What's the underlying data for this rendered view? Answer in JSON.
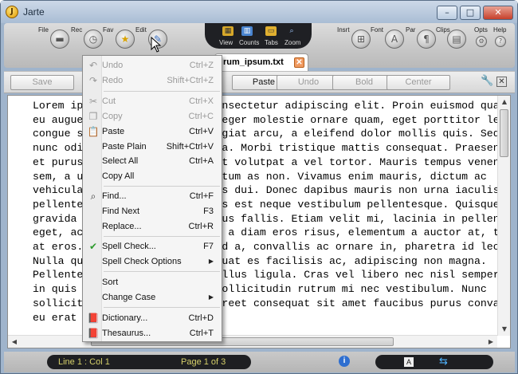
{
  "window": {
    "title": "Jarte",
    "app_icon": "J"
  },
  "ribbon": {
    "left_buttons": [
      {
        "label": "File",
        "icon": "folder-icon"
      },
      {
        "label": "Rec",
        "icon": "clock-icon"
      },
      {
        "label": "Fav",
        "icon": "star-icon"
      },
      {
        "label": "Edit",
        "icon": "edit-icon"
      }
    ],
    "middle": [
      {
        "label": "View"
      },
      {
        "label": "Counts"
      },
      {
        "label": "Tabs"
      },
      {
        "label": "Zoom"
      }
    ],
    "right_buttons": [
      {
        "label": "Insrt"
      },
      {
        "label": "Font"
      },
      {
        "label": "Par"
      },
      {
        "label": "Clips"
      },
      {
        "label": "Opts"
      },
      {
        "label": "Help"
      }
    ]
  },
  "document_tab": {
    "name": "rum_ipsum.txt"
  },
  "toolbar": {
    "save": "Save",
    "paste": "Paste",
    "undo": "Undo",
    "bold": "Bold",
    "center": "Center"
  },
  "editor_text": "Lorem ipsum dolor sit amet, consectetur adipiscing elit. Proin euismod quam\neu augue vehicula dapibus. Integer molestie ornare quam, eget porttitor leo\ncongue sit amet. Phasellus feugiat arcu, a eleifend dolor mollis quis. Sed ut\nnunc odio, sed condimentum urna. Morbi tristique mattis consequat. Praesent\net purus pharetra massa blandit volutpat a vel tortor. Mauris tempus venenatis\nsem, a ultrices ipsum condimentum as non. Vivamus enim mauris, dictum ac\nvehicula ut, hendrerit ultrices dui. Donec dapibus mauris non urna iaculis\npellentesque. Aliquam at luctus est neque vestibulum pellentesque. Quisque\ngravida tellus vel tortor tempus fallis. Etiam velit mi, lacinia in pellentesque\neget, accumsan a felis. Aenean a diam eros risus, elementum a auctor at, tempor\nat eros. Sed vestibulum euismod a, convallis ac ornare in, pharetra id leo.\nNulla quis lectus nibh, consequat es facilisis ac, adipiscing non magna.\nPellentesque eget velit vel tellus ligula. Cras vel libero nec nisl semper pulvinar\nin quis neque. Proin sem mi, sollicitudin rutrum mi nec vestibulum. Nunc\nsollicitudin, libero vitae laoreet consequat sit amet faucibus purus convallis. Ut\neu erat",
  "status": {
    "position": "Line 1 : Col 1",
    "page": "Page 1 of 3"
  },
  "edit_menu": {
    "items": [
      {
        "label": "Undo",
        "shortcut": "Ctrl+Z",
        "disabled": true,
        "icon": "undo-icon"
      },
      {
        "label": "Redo",
        "shortcut": "Shift+Ctrl+Z",
        "disabled": true,
        "icon": "redo-icon"
      },
      {
        "label": "Cut",
        "shortcut": "Ctrl+X",
        "disabled": true,
        "icon": "scissors-icon"
      },
      {
        "label": "Copy",
        "shortcut": "Ctrl+C",
        "disabled": true,
        "icon": "copy-icon"
      },
      {
        "label": "Paste",
        "shortcut": "Ctrl+V",
        "disabled": false,
        "icon": "paste-icon"
      },
      {
        "label": "Paste Plain",
        "shortcut": "Shift+Ctrl+V",
        "disabled": false
      },
      {
        "label": "Select All",
        "shortcut": "Ctrl+A",
        "disabled": false
      },
      {
        "label": "Copy All",
        "shortcut": "",
        "disabled": false
      },
      {
        "label": "Find...",
        "shortcut": "Ctrl+F",
        "disabled": false,
        "icon": "binoculars-icon"
      },
      {
        "label": "Find Next",
        "shortcut": "F3",
        "disabled": false
      },
      {
        "label": "Replace...",
        "shortcut": "Ctrl+R",
        "disabled": false
      },
      {
        "label": "Spell Check...",
        "shortcut": "F7",
        "disabled": false,
        "icon": "spellcheck-icon"
      },
      {
        "label": "Spell Check Options",
        "shortcut": "",
        "disabled": false,
        "submenu": true
      },
      {
        "label": "Sort",
        "shortcut": "",
        "disabled": false
      },
      {
        "label": "Change Case",
        "shortcut": "",
        "disabled": false,
        "submenu": true
      },
      {
        "label": "Dictionary...",
        "shortcut": "Ctrl+D",
        "disabled": false,
        "icon": "dictionary-icon"
      },
      {
        "label": "Thesaurus...",
        "shortcut": "Ctrl+T",
        "disabled": false,
        "icon": "thesaurus-icon"
      }
    ]
  }
}
